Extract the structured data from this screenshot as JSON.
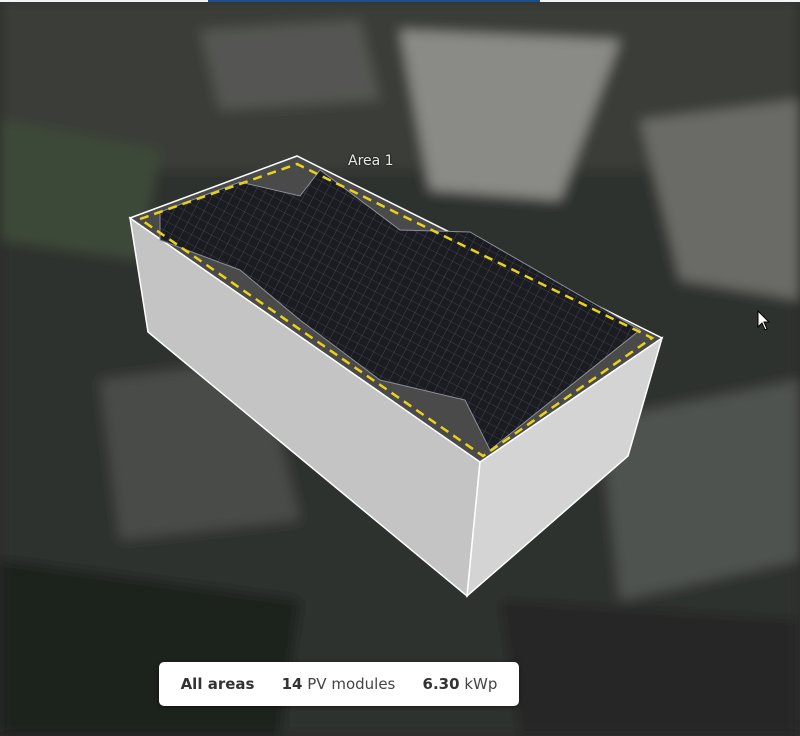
{
  "map": {
    "area_label": "Area 1"
  },
  "summary": {
    "scope": "All areas",
    "module_count": "14",
    "module_label": "PV modules",
    "power_value": "6.30",
    "power_unit": "kWp"
  },
  "colors": {
    "boundary": "#e8d21a",
    "box": "#b9b9b9",
    "panel": "#1b1d22",
    "accent_bar": "#1f4e8c"
  }
}
